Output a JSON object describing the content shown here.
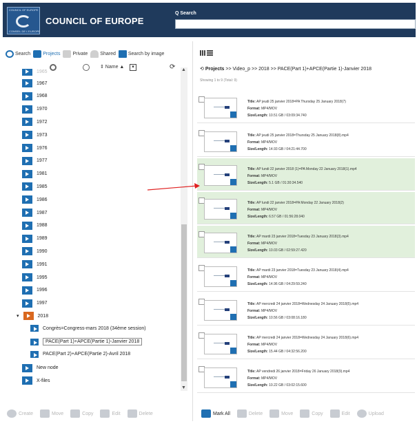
{
  "header": {
    "brand": "COUNCIL OF EUROPE",
    "logo_top": "COUNCIL OF EUROPE",
    "logo_bottom": "CONSEIL DE L'EUROPE",
    "search_label": "Q Search"
  },
  "tabs": [
    {
      "label": "Search",
      "icon": "search-icon"
    },
    {
      "label": "Projects",
      "icon": "folder-icon"
    },
    {
      "label": "Private",
      "icon": "lock-icon"
    },
    {
      "label": "Shared",
      "icon": "user-icon"
    },
    {
      "label": "Search by image",
      "icon": "image-icon"
    }
  ],
  "tree_toolbar": {
    "sort_label": "⇕ Name ▲",
    "select_glyph": "▾",
    "refresh_glyph": "⟳"
  },
  "tree": {
    "partial_top": "1965",
    "years": [
      "1967",
      "1968",
      "1970",
      "1972",
      "1973",
      "1976",
      "1977",
      "1981",
      "1985",
      "1986",
      "1987",
      "1988",
      "1989",
      "1990",
      "1991",
      "1995",
      "1996",
      "1997"
    ],
    "expanded": "2018",
    "children": [
      "Congrès=Congress-mars 2018 (34ème session)",
      "PACE(Part 1)+APCE(Partie 1)-Janvier 2018",
      "PACE(Part 2)+APCE(Partie 2)-Avril 2018"
    ],
    "selected_child_index": 1,
    "after": [
      "New node",
      "X-files"
    ]
  },
  "left_bottom": {
    "create": "Create",
    "move": "Move",
    "copy": "Copy",
    "edit": "Edit",
    "delete": "Delete"
  },
  "right": {
    "breadcrumb_root": "Projects",
    "breadcrumb_rest": " >> Video_p >> 2018 >> PACE(Part 1)+APCE(Partie 1)-Janvier 2018",
    "showing": "Showing 1 to 9 (Total: 9)",
    "labels": {
      "title": "Title:",
      "format": "Format:",
      "size": "Size/Length:"
    },
    "files": [
      {
        "title": "AP jeudi 25 janvier 2018=PA Thursday 25 January 2018(7)",
        "format": "MP4/MOV",
        "size": "10.51 GB / 03:09:34.740",
        "highlight": false
      },
      {
        "title": "AP jeudi 25 janvier 2018=Thursday 25 January 2018(8).mp4",
        "format": "MP4/MOV",
        "size": "14.93 GB / 04:21:44.700",
        "highlight": false
      },
      {
        "title": "AP lundi 22 janvier 2018 (1)=PA Monday 22 January 2018(1).mp4",
        "format": "MP4/MOV",
        "size": "5.1 GB / 01:30:34.540",
        "highlight": true
      },
      {
        "title": "AP lundi 22 janvier 2018=PA Monday 22 January 2018(2)",
        "format": "MP4/MOV",
        "size": "6.57 GB / 01:56:28.040",
        "highlight": true
      },
      {
        "title": "AP mardi 23 janvier 2018=Tuesday 23 January 2018(3).mp4",
        "format": "MP4/MOV",
        "size": "10.03 GB / 02:59:27.420",
        "highlight": true
      },
      {
        "title": "AP mardi 23 janvier 2018=Tuesday 23 January 2018(4).mp4",
        "format": "MP4/MOV",
        "size": "14.96 GB / 04:29:59.240",
        "highlight": false
      },
      {
        "title": "AP mercredi 24 janvier 2018=Wednesday 24 January 2018(5).mp4",
        "format": "MP4/MOV",
        "size": "10.56 GB / 03:08:16.180",
        "highlight": false
      },
      {
        "title": "AP mercredi 24 janvier 2018=Wednesday 24 January 2018(6).mp4",
        "format": "MP4/MOV",
        "size": "15.44 GB / 04:32:56.200",
        "highlight": false
      },
      {
        "title": "AP vendredi 26 janvier 2018=Friday 26 January 2018(9).mp4",
        "format": "MP4/MOV",
        "size": "10.22 GB / 03:02:15.600",
        "highlight": false
      }
    ]
  },
  "right_bottom": {
    "mark_all": "Mark All",
    "delete": "Delete",
    "move": "Move",
    "copy": "Copy",
    "edit": "Edit",
    "upload": "Upload"
  },
  "colors": {
    "header_bg": "#1f3a5c",
    "accent": "#1f6fb2",
    "folder_open": "#d9681f",
    "row_highlight": "#e1f0dc",
    "annotation_arrow": "#e02020"
  }
}
